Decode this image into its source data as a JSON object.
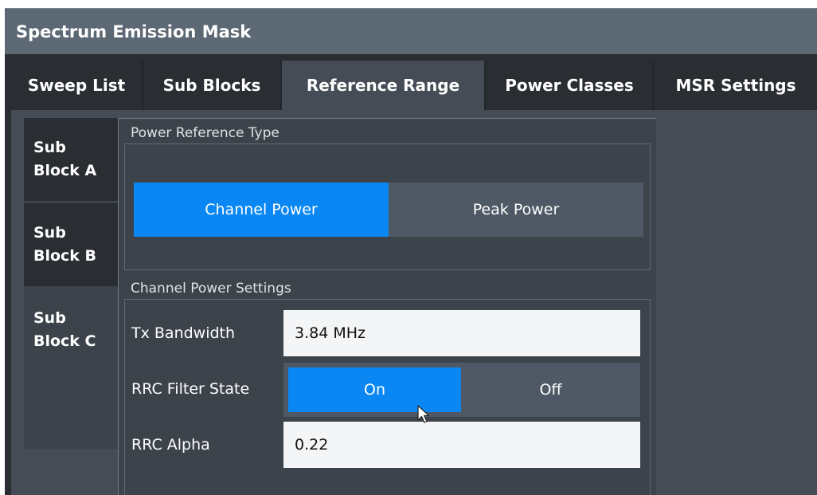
{
  "window": {
    "title": "Spectrum Emission Mask"
  },
  "tabs": [
    {
      "label": "Sweep List"
    },
    {
      "label": "Sub Blocks"
    },
    {
      "label": "Reference Range"
    },
    {
      "label": "Power Classes"
    },
    {
      "label": "MSR Settings"
    }
  ],
  "active_tab": "Reference Range",
  "sub_blocks": [
    {
      "line1": "Sub",
      "line2": "Block A"
    },
    {
      "line1": "Sub",
      "line2": "Block B"
    },
    {
      "line1": "Sub",
      "line2": "Block C"
    }
  ],
  "active_sub_block": "Block C",
  "power_reference": {
    "group_label": "Power Reference Type",
    "options": [
      "Channel Power",
      "Peak Power"
    ],
    "selected": "Channel Power"
  },
  "channel_power_settings": {
    "group_label": "Channel Power Settings",
    "tx_bandwidth": {
      "label": "Tx Bandwidth",
      "value": "3.84 MHz"
    },
    "rrc_filter_state": {
      "label": "RRC Filter State",
      "options": [
        "On",
        "Off"
      ],
      "selected": "On"
    },
    "rrc_alpha": {
      "label": "RRC Alpha",
      "value": "0.22"
    }
  },
  "colors": {
    "accent": "#0a87f2",
    "titlebar": "#5c6874",
    "panel": "#3c434b",
    "background": "#2a2d31"
  },
  "icons": {
    "pointer": "mouse-pointer-icon"
  }
}
